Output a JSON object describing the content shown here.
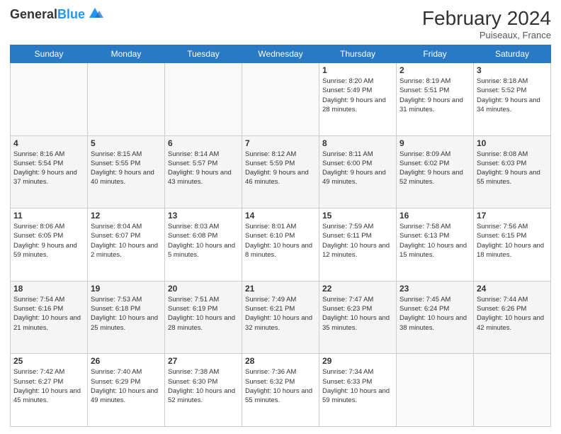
{
  "header": {
    "logo_general": "General",
    "logo_blue": "Blue",
    "month_title": "February 2024",
    "location": "Puiseaux, France"
  },
  "weekdays": [
    "Sunday",
    "Monday",
    "Tuesday",
    "Wednesday",
    "Thursday",
    "Friday",
    "Saturday"
  ],
  "weeks": [
    [
      {
        "day": "",
        "info": ""
      },
      {
        "day": "",
        "info": ""
      },
      {
        "day": "",
        "info": ""
      },
      {
        "day": "",
        "info": ""
      },
      {
        "day": "1",
        "info": "Sunrise: 8:20 AM\nSunset: 5:49 PM\nDaylight: 9 hours\nand 28 minutes."
      },
      {
        "day": "2",
        "info": "Sunrise: 8:19 AM\nSunset: 5:51 PM\nDaylight: 9 hours\nand 31 minutes."
      },
      {
        "day": "3",
        "info": "Sunrise: 8:18 AM\nSunset: 5:52 PM\nDaylight: 9 hours\nand 34 minutes."
      }
    ],
    [
      {
        "day": "4",
        "info": "Sunrise: 8:16 AM\nSunset: 5:54 PM\nDaylight: 9 hours\nand 37 minutes."
      },
      {
        "day": "5",
        "info": "Sunrise: 8:15 AM\nSunset: 5:55 PM\nDaylight: 9 hours\nand 40 minutes."
      },
      {
        "day": "6",
        "info": "Sunrise: 8:14 AM\nSunset: 5:57 PM\nDaylight: 9 hours\nand 43 minutes."
      },
      {
        "day": "7",
        "info": "Sunrise: 8:12 AM\nSunset: 5:59 PM\nDaylight: 9 hours\nand 46 minutes."
      },
      {
        "day": "8",
        "info": "Sunrise: 8:11 AM\nSunset: 6:00 PM\nDaylight: 9 hours\nand 49 minutes."
      },
      {
        "day": "9",
        "info": "Sunrise: 8:09 AM\nSunset: 6:02 PM\nDaylight: 9 hours\nand 52 minutes."
      },
      {
        "day": "10",
        "info": "Sunrise: 8:08 AM\nSunset: 6:03 PM\nDaylight: 9 hours\nand 55 minutes."
      }
    ],
    [
      {
        "day": "11",
        "info": "Sunrise: 8:06 AM\nSunset: 6:05 PM\nDaylight: 9 hours\nand 59 minutes."
      },
      {
        "day": "12",
        "info": "Sunrise: 8:04 AM\nSunset: 6:07 PM\nDaylight: 10 hours\nand 2 minutes."
      },
      {
        "day": "13",
        "info": "Sunrise: 8:03 AM\nSunset: 6:08 PM\nDaylight: 10 hours\nand 5 minutes."
      },
      {
        "day": "14",
        "info": "Sunrise: 8:01 AM\nSunset: 6:10 PM\nDaylight: 10 hours\nand 8 minutes."
      },
      {
        "day": "15",
        "info": "Sunrise: 7:59 AM\nSunset: 6:11 PM\nDaylight: 10 hours\nand 12 minutes."
      },
      {
        "day": "16",
        "info": "Sunrise: 7:58 AM\nSunset: 6:13 PM\nDaylight: 10 hours\nand 15 minutes."
      },
      {
        "day": "17",
        "info": "Sunrise: 7:56 AM\nSunset: 6:15 PM\nDaylight: 10 hours\nand 18 minutes."
      }
    ],
    [
      {
        "day": "18",
        "info": "Sunrise: 7:54 AM\nSunset: 6:16 PM\nDaylight: 10 hours\nand 21 minutes."
      },
      {
        "day": "19",
        "info": "Sunrise: 7:53 AM\nSunset: 6:18 PM\nDaylight: 10 hours\nand 25 minutes."
      },
      {
        "day": "20",
        "info": "Sunrise: 7:51 AM\nSunset: 6:19 PM\nDaylight: 10 hours\nand 28 minutes."
      },
      {
        "day": "21",
        "info": "Sunrise: 7:49 AM\nSunset: 6:21 PM\nDaylight: 10 hours\nand 32 minutes."
      },
      {
        "day": "22",
        "info": "Sunrise: 7:47 AM\nSunset: 6:23 PM\nDaylight: 10 hours\nand 35 minutes."
      },
      {
        "day": "23",
        "info": "Sunrise: 7:45 AM\nSunset: 6:24 PM\nDaylight: 10 hours\nand 38 minutes."
      },
      {
        "day": "24",
        "info": "Sunrise: 7:44 AM\nSunset: 6:26 PM\nDaylight: 10 hours\nand 42 minutes."
      }
    ],
    [
      {
        "day": "25",
        "info": "Sunrise: 7:42 AM\nSunset: 6:27 PM\nDaylight: 10 hours\nand 45 minutes."
      },
      {
        "day": "26",
        "info": "Sunrise: 7:40 AM\nSunset: 6:29 PM\nDaylight: 10 hours\nand 49 minutes."
      },
      {
        "day": "27",
        "info": "Sunrise: 7:38 AM\nSunset: 6:30 PM\nDaylight: 10 hours\nand 52 minutes."
      },
      {
        "day": "28",
        "info": "Sunrise: 7:36 AM\nSunset: 6:32 PM\nDaylight: 10 hours\nand 55 minutes."
      },
      {
        "day": "29",
        "info": "Sunrise: 7:34 AM\nSunset: 6:33 PM\nDaylight: 10 hours\nand 59 minutes."
      },
      {
        "day": "",
        "info": ""
      },
      {
        "day": "",
        "info": ""
      }
    ]
  ]
}
